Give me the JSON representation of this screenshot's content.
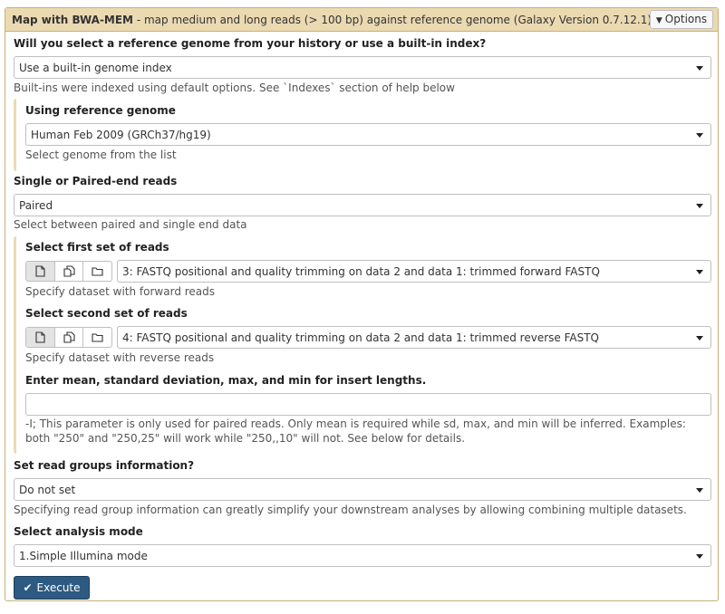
{
  "header": {
    "tool_name": "Map with BWA-MEM",
    "tool_description": "- map medium and long reads (> 100 bp) against reference genome (Galaxy Version 0.7.12.1)",
    "options_label": "Options"
  },
  "reference_source": {
    "label": "Will you select a reference genome from your history or use a built-in index?",
    "value": "Use a built-in genome index",
    "help": "Built-ins were indexed using default options. See `Indexes` section of help below"
  },
  "reference_genome": {
    "label": "Using reference genome",
    "value": "Human Feb 2009 (GRCh37/hg19)",
    "help": "Select genome from the list"
  },
  "read_type": {
    "label": "Single or Paired-end reads",
    "value": "Paired",
    "help": "Select between paired and single end data"
  },
  "first_reads": {
    "label": "Select first set of reads",
    "value": "3: FASTQ positional and quality trimming on data 2 and data 1: trimmed forward FASTQ",
    "help": "Specify dataset with forward reads"
  },
  "second_reads": {
    "label": "Select second set of reads",
    "value": "4: FASTQ positional and quality trimming on data 2 and data 1: trimmed reverse FASTQ",
    "help": "Specify dataset with reverse reads"
  },
  "insert_lengths": {
    "label": "Enter mean, standard deviation, max, and min for insert lengths.",
    "value": "",
    "help": "-I; This parameter is only used for paired reads. Only mean is required while sd, max, and min will be inferred. Examples: both \"250\" and \"250,25\" will work while \"250,,10\" will not. See below for details."
  },
  "read_groups": {
    "label": "Set read groups information?",
    "value": "Do not set",
    "help": "Specifying read group information can greatly simplify your downstream analyses by allowing combining multiple datasets."
  },
  "analysis_mode": {
    "label": "Select analysis mode",
    "value": "1.Simple Illumina mode"
  },
  "execute_label": "Execute",
  "colors": {
    "header_bg": "#ebd9b2",
    "border": "#c7b07b",
    "execute_bg": "#2c5a83"
  }
}
